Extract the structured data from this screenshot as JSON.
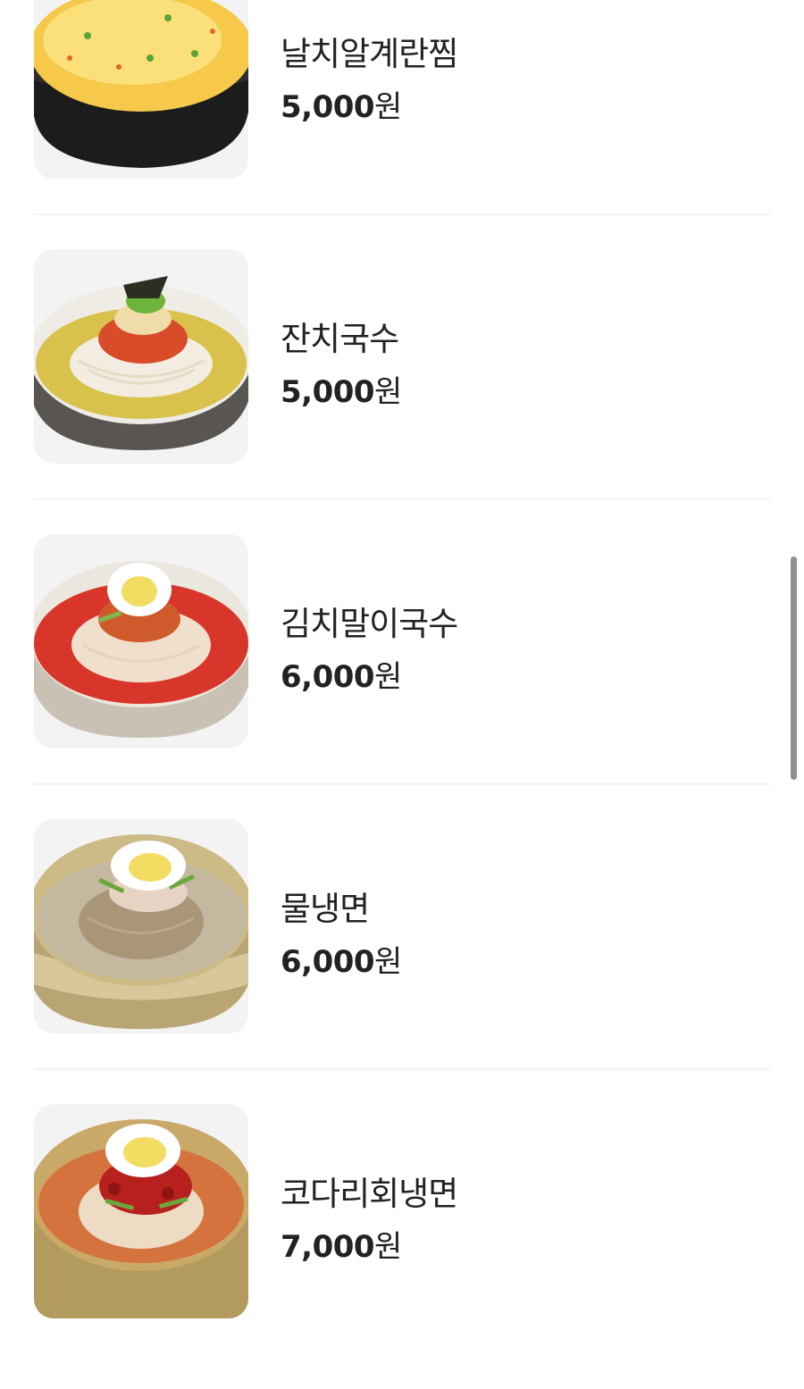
{
  "menu": {
    "items": [
      {
        "name": "날치알계란찜",
        "price": "5,000",
        "unit": "원",
        "icon": "steamed-egg-image"
      },
      {
        "name": "잔치국수",
        "price": "5,000",
        "unit": "원",
        "icon": "banquet-noodles-image"
      },
      {
        "name": "김치말이국수",
        "price": "6,000",
        "unit": "원",
        "icon": "kimchi-noodles-image"
      },
      {
        "name": "물냉면",
        "price": "6,000",
        "unit": "원",
        "icon": "cold-noodles-image"
      },
      {
        "name": "코다리회냉면",
        "price": "7,000",
        "unit": "원",
        "icon": "spicy-cold-noodles-image"
      }
    ]
  },
  "colors": {
    "text": "#222222",
    "divider": "#f1f1f1",
    "thumb_bg": "#f3f3f4",
    "scrollbar": "#8f8f8f"
  }
}
